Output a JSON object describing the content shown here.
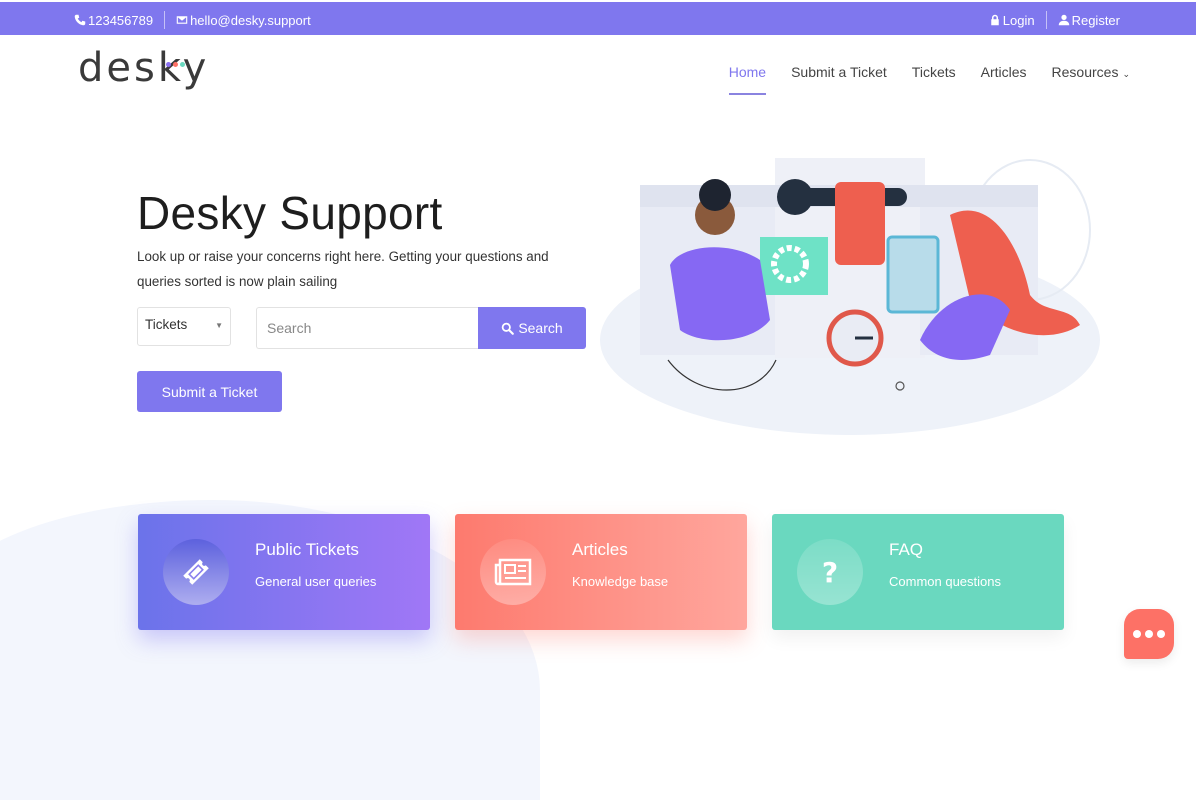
{
  "topbar": {
    "phone": "123456789",
    "email": "hello@desky.support",
    "login": "Login",
    "register": "Register",
    "icons": {
      "phone": "phone-icon",
      "email": "envelope-icon",
      "login": "lock-icon",
      "register": "user-icon"
    }
  },
  "brand": {
    "logo_text": "desky",
    "dot_colors": [
      "#8a6ff0",
      "#fd7166",
      "#6ad8bf"
    ]
  },
  "nav": {
    "items": [
      {
        "label": "Home",
        "active": true
      },
      {
        "label": "Submit a Ticket"
      },
      {
        "label": "Tickets"
      },
      {
        "label": "Articles"
      },
      {
        "label": "Resources",
        "has_dropdown": true
      }
    ],
    "dropdown_caret": "⌄"
  },
  "hero": {
    "title": "Desky Support",
    "subtitle": "Look up or raise your concerns right here. Getting your questions and queries sorted is now plain sailing",
    "category_select": {
      "selected": "Tickets"
    },
    "search": {
      "placeholder": "Search",
      "value": "",
      "button_label": "Search"
    },
    "submit_ticket_label": "Submit a Ticket",
    "illustration": "support-team-illustration"
  },
  "cards": [
    {
      "title": "Public Tickets",
      "subtitle": "General user queries",
      "icon": "ticket-icon",
      "color": "#7f77ee"
    },
    {
      "title": "Articles",
      "subtitle": "Knowledge base",
      "icon": "newspaper-icon",
      "color": "#fd7a6e"
    },
    {
      "title": "FAQ",
      "subtitle": "Common questions",
      "icon": "question-icon",
      "color": "#6ad8bf"
    }
  ],
  "chat": {
    "icon": "chat-ellipsis-icon"
  },
  "colors": {
    "accent": "#7f77ee",
    "coral": "#fd7166",
    "mint": "#6ad8bf"
  }
}
